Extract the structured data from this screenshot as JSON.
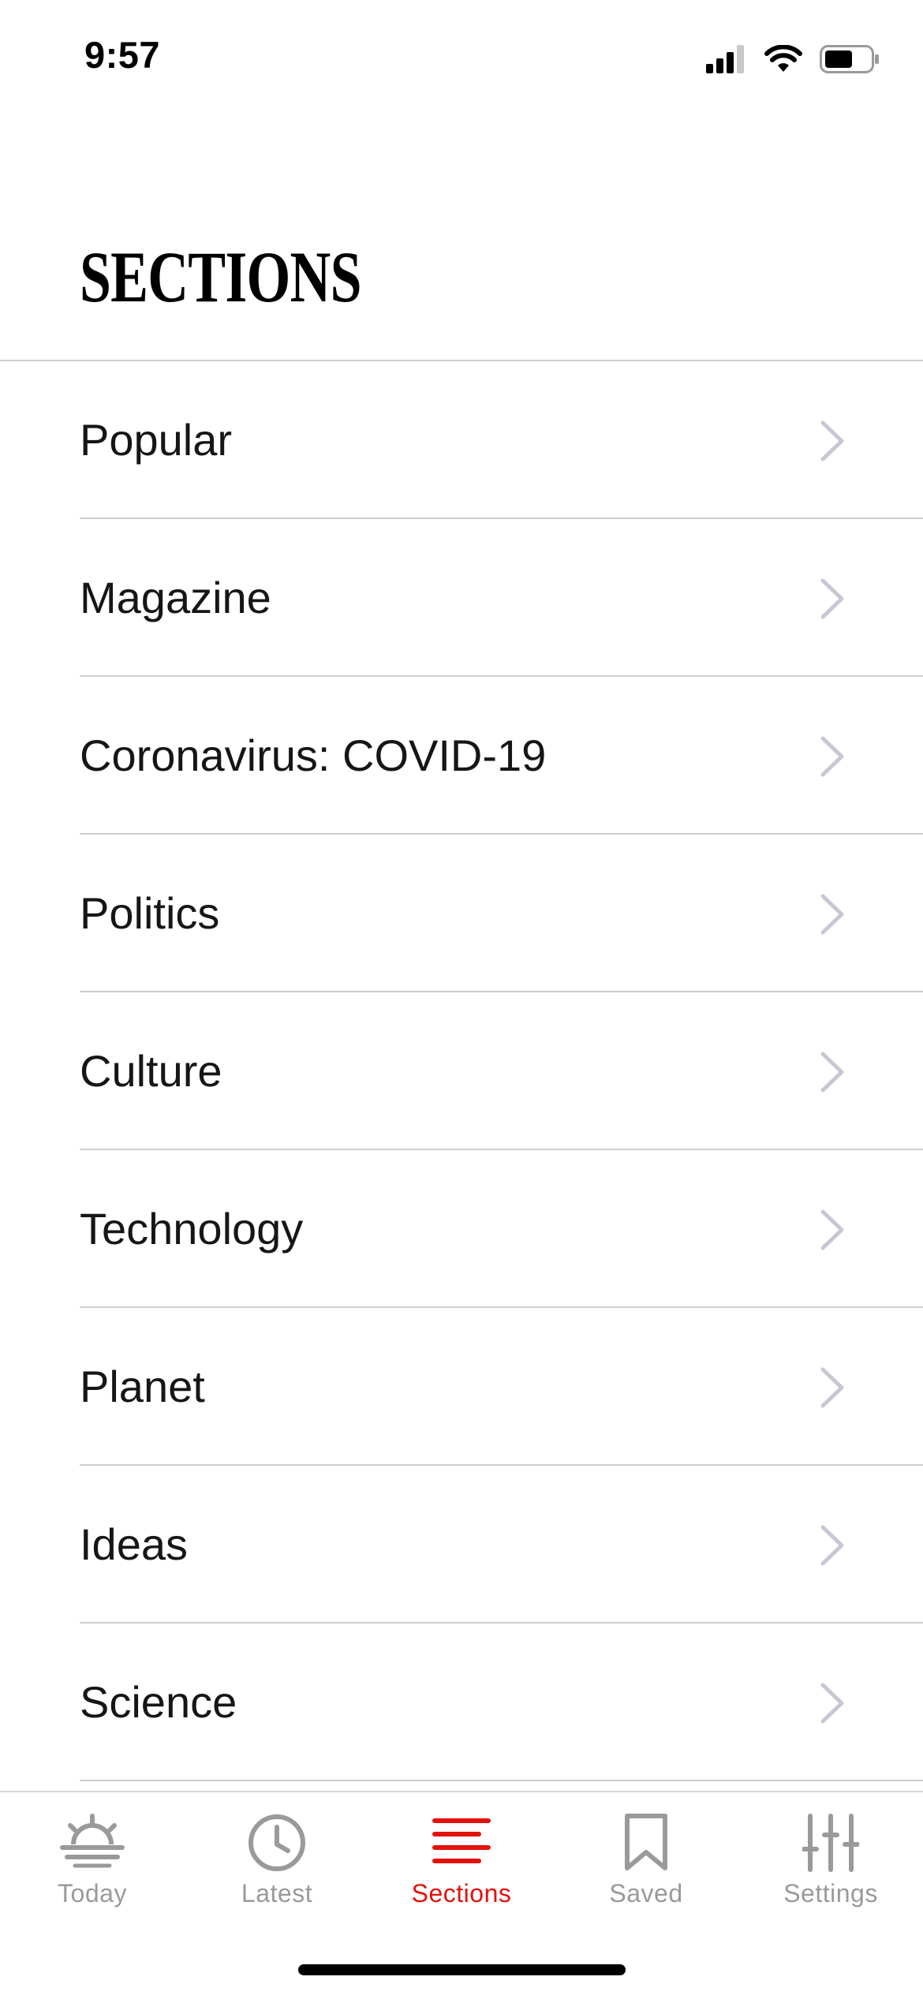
{
  "status_bar": {
    "time": "9:57"
  },
  "header": {
    "title": "SECTIONS"
  },
  "sections": [
    {
      "label": "Popular"
    },
    {
      "label": "Magazine"
    },
    {
      "label": "Coronavirus: COVID-19"
    },
    {
      "label": "Politics"
    },
    {
      "label": "Culture"
    },
    {
      "label": "Technology"
    },
    {
      "label": "Planet"
    },
    {
      "label": "Ideas"
    },
    {
      "label": "Science"
    }
  ],
  "tab_bar": {
    "tabs": [
      {
        "label": "Today",
        "icon": "sunrise-icon"
      },
      {
        "label": "Latest",
        "icon": "clock-icon"
      },
      {
        "label": "Sections",
        "icon": "menu-lines-icon",
        "active": true
      },
      {
        "label": "Saved",
        "icon": "bookmark-icon"
      },
      {
        "label": "Settings",
        "icon": "sliders-icon"
      }
    ]
  },
  "colors": {
    "accent": "#e3120b",
    "inactive": "#9a9a9a",
    "chevron": "#c5c8d4",
    "divider": "#cdcdcd"
  }
}
